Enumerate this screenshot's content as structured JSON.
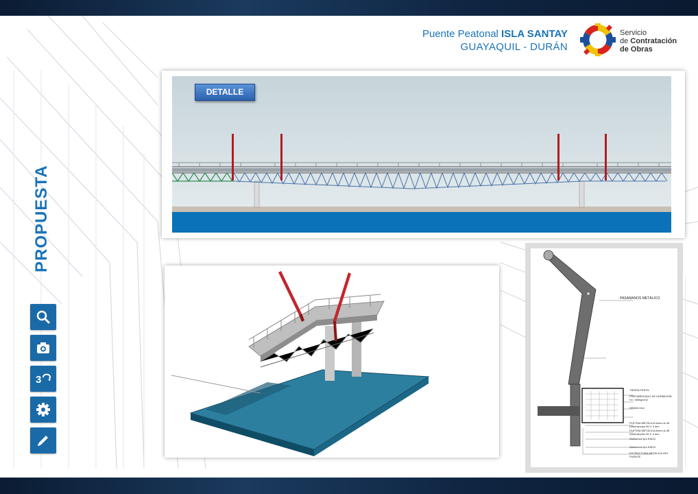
{
  "header": {
    "title_prefix": "Puente Peatonal ",
    "title_bold": "ISLA SANTAY",
    "subtitle": "GUAYAQUIL - DURÁN"
  },
  "logo": {
    "line1": "Servicio",
    "line2_prefix": "de ",
    "line2_bold": "Contratación",
    "line3": "de Obras"
  },
  "side_title": "PROPUESTA",
  "tools": [
    "search-icon",
    "camera-icon",
    "3d-icon",
    "gear-icon",
    "pencil-icon"
  ],
  "elevation": {
    "button_label": "DETALLE"
  },
  "detail_drawing": {
    "label_main": "PASAMANOS METÁLICO",
    "labels": [
      "TIERRA FERTIL",
      "PREFABRICADO DE HORMIGÓN f'c= 180kg/cm2",
      "GRAVA 2cm",
      "PLETINA METÁLICA Acero A-36 Dimensiones 50 X 3 mm",
      "PLETINA METÁLICA Acero A-36 Dimensiones 50 X 3 mm",
      "Soldadura tipo E6011",
      "Soldadura tipo E6011",
      "ESTRUCTURA METÁLICA DEL PUENTE"
    ]
  },
  "colors": {
    "brand_blue": "#1a73b8",
    "tool_blue": "#1b6aa8",
    "pylon_red": "#b01c22",
    "water_blue": "#0a72b8"
  }
}
